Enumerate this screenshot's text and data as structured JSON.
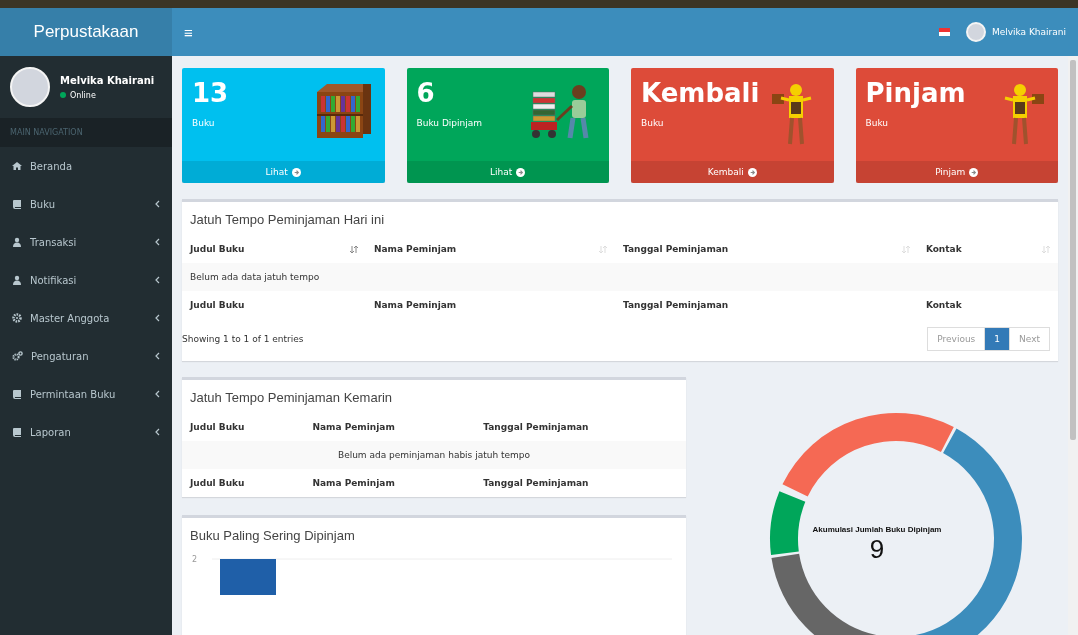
{
  "brand": "Perpustakaan",
  "header": {
    "menu_glyph": "≡",
    "user_name": "Melvika Khairani"
  },
  "user_panel": {
    "name": "Melvika Khairani",
    "status": "Online"
  },
  "nav_heading": "MAIN NAVIGATION",
  "nav_items": [
    {
      "label": "Beranda",
      "has_children": false
    },
    {
      "label": "Buku",
      "has_children": true
    },
    {
      "label": "Transaksi",
      "has_children": true
    },
    {
      "label": "Notifikasi",
      "has_children": true
    },
    {
      "label": "Master Anggota",
      "has_children": true
    },
    {
      "label": "Pengaturan",
      "has_children": true
    },
    {
      "label": "Permintaan Buku",
      "has_children": true
    },
    {
      "label": "Laporan",
      "has_children": true
    }
  ],
  "stat_cards": [
    {
      "value": "13",
      "label": "Buku",
      "link": "Lihat",
      "color": "#00c0ef"
    },
    {
      "value": "6",
      "label": "Buku Dipinjam",
      "link": "Lihat",
      "color": "#00a65a"
    },
    {
      "value": "Kembali",
      "label": "Buku",
      "link": "Kembali",
      "color": "#dd4b39"
    },
    {
      "value": "Pinjam",
      "label": "Buku",
      "link": "Pinjam",
      "color": "#dd4b39"
    }
  ],
  "today_table": {
    "title": "Jatuh Tempo Peminjaman Hari ini",
    "columns": [
      {
        "label": "Judul Buku",
        "sorted": true
      },
      {
        "label": "Nama Peminjam",
        "sorted": false
      },
      {
        "label": "Tanggal Peminjaman",
        "sorted": false
      },
      {
        "label": "Kontak",
        "sorted": false
      }
    ],
    "empty_message": "Belum ada data jatuh tempo",
    "footer_columns": [
      "Judul Buku",
      "Nama Peminjam",
      "Tanggal Peminjaman",
      "Kontak"
    ],
    "info": "Showing 1 to 1 of 1 entries",
    "pagination": [
      {
        "label": "Previous",
        "selected": false
      },
      {
        "label": "1",
        "selected": true
      },
      {
        "label": "Next",
        "selected": false
      }
    ]
  },
  "yesterday_table": {
    "title": "Jatuh Tempo Peminjaman Kemarin",
    "columns": [
      "Judul Buku",
      "Nama Peminjam",
      "Tanggal Peminjaman"
    ],
    "empty_message": "Belum ada peminjaman habis jatuh tempo",
    "footer_columns": [
      "Judul Buku",
      "Nama Peminjam",
      "Tanggal Peminjaman"
    ]
  },
  "popular_books": {
    "title": "Buku Paling Sering Dipinjam",
    "axis_tick": "2"
  },
  "donut": {
    "title": "Akumulasi Jumlah Buku Dipinjam",
    "total": "9"
  }
}
